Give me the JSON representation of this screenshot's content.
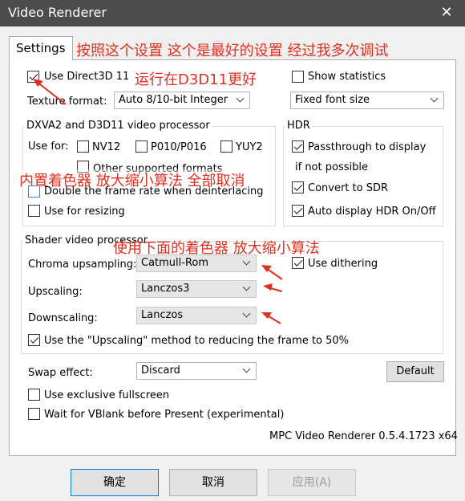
{
  "window": {
    "title": "Video Renderer",
    "close_glyph": "✕"
  },
  "tabs": [
    {
      "label": "Settings"
    }
  ],
  "annotations": {
    "top_note": "按照这个设置 这个是最好的设置 经过我多次调试",
    "d3d_note": "运行在D3D11更好",
    "processor_note": "内置着色器 放大缩小算法 全部取消",
    "shader_note": "使用下面的着色器 放大缩小算法",
    "arrow_color": "#e03020"
  },
  "general": {
    "use_d3d11": {
      "label": "Use Direct3D 11",
      "checked": true
    },
    "show_statistics": {
      "label": "Show statistics",
      "checked": false
    },
    "texture_format_label": "Texture format:",
    "texture_format_value": "Auto 8/10-bit Integer",
    "font_size_value": "Fixed font size"
  },
  "processor": {
    "title": "DXVA2 and D3D11 video processor",
    "use_for_label": "Use for:",
    "nv12": {
      "label": "NV12",
      "checked": false
    },
    "p010": {
      "label": "P010/P016",
      "checked": false
    },
    "yuy2": {
      "label": "YUY2",
      "checked": false
    },
    "other_formats": {
      "label": "Other supported formats",
      "checked": false
    },
    "double_frame_rate": {
      "label": "Double the frame rate when deinterlacing",
      "checked": false
    },
    "use_for_resizing": {
      "label": "Use for resizing",
      "checked": false
    }
  },
  "hdr": {
    "title": "HDR",
    "passthrough": {
      "label": "Passthrough to display",
      "checked": true
    },
    "passthrough_cont": "if not possible",
    "convert_sdr": {
      "label": "Convert to SDR",
      "checked": true
    },
    "auto_display": {
      "label": "Auto display HDR On/Off",
      "checked": true
    }
  },
  "shader": {
    "title": "Shader video processor",
    "chroma_label": "Chroma upsampling:",
    "chroma_value": "Catmull-Rom",
    "dithering": {
      "label": "Use dithering",
      "checked": true
    },
    "upscaling_label": "Upscaling:",
    "upscaling_value": "Lanczos3",
    "downscaling_label": "Downscaling:",
    "downscaling_value": "Lanczos",
    "reduce_half": {
      "label": "Use the \"Upscaling\" method to reducing the frame to 50%",
      "checked": true
    }
  },
  "swap": {
    "label": "Swap effect:",
    "value": "Discard",
    "default_button": "Default"
  },
  "exclusive_fullscreen": {
    "label": "Use exclusive fullscreen",
    "checked": false
  },
  "wait_vblank": {
    "label": "Wait for VBlank before Present (experimental)",
    "checked": false
  },
  "version": "MPC Video Renderer 0.5.4.1723 x64",
  "footer": {
    "ok": "确定",
    "cancel": "取消",
    "apply": "应用(A)"
  }
}
